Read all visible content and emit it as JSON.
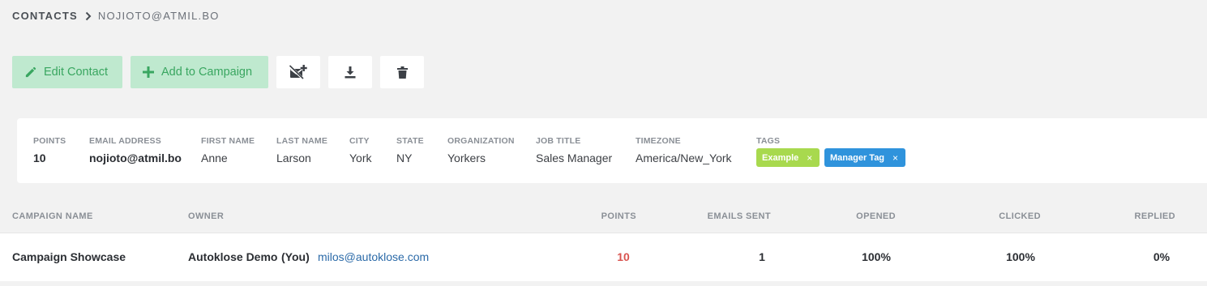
{
  "breadcrumb": {
    "root": "CONTACTS",
    "current": "NOJIOTO@ATMIL.BO"
  },
  "toolbar": {
    "edit_label": "Edit Contact",
    "add_campaign_label": "Add to Campaign",
    "icons": [
      "pencil-icon",
      "plus-icon",
      "unsubscribe-icon",
      "download-icon",
      "trash-icon"
    ]
  },
  "contact": {
    "fields": [
      {
        "label": "POINTS",
        "value": "10"
      },
      {
        "label": "EMAIL ADDRESS",
        "value": "nojioto@atmil.bo"
      },
      {
        "label": "FIRST NAME",
        "value": "Anne"
      },
      {
        "label": "LAST NAME",
        "value": "Larson"
      },
      {
        "label": "CITY",
        "value": "York"
      },
      {
        "label": "STATE",
        "value": "NY"
      },
      {
        "label": "ORGANIZATION",
        "value": "Yorkers"
      },
      {
        "label": "JOB TITLE",
        "value": "Sales Manager"
      },
      {
        "label": "TIMEZONE",
        "value": "America/New_York"
      }
    ],
    "tags_label": "TAGS",
    "tags": [
      {
        "label": "Example",
        "color": "#a8d94e"
      },
      {
        "label": "Manager Tag",
        "color": "#2f93dc"
      }
    ],
    "tag_remove": "×"
  },
  "campaigns": {
    "headers": [
      "CAMPAIGN NAME",
      "OWNER",
      "POINTS",
      "EMAILS SENT",
      "OPENED",
      "CLICKED",
      "REPLIED"
    ],
    "rows": [
      {
        "name": "Campaign Showcase",
        "owner_name": "Autoklose Demo",
        "owner_you": "(You)",
        "owner_email": "milos@autoklose.com",
        "points": "10",
        "emails_sent": "1",
        "opened": "100%",
        "clicked": "100%",
        "replied": "0%"
      }
    ]
  },
  "colors": {
    "accent_green": "#39a660",
    "button_green_bg": "#bfe9cf",
    "points_red": "#d9534f",
    "link_blue": "#2b6aa8"
  }
}
